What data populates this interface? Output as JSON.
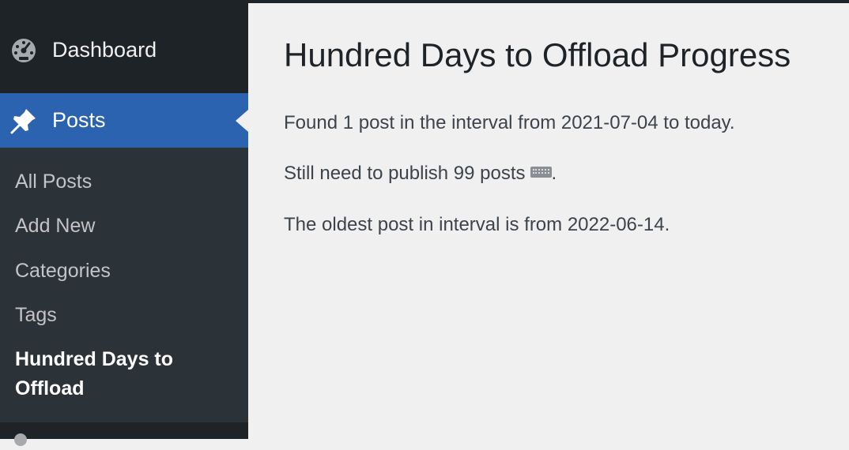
{
  "sidebar": {
    "dashboard": {
      "label": "Dashboard",
      "icon": "dashboard-gauge-icon"
    },
    "posts": {
      "label": "Posts",
      "icon": "pin-icon",
      "active_color": "#2c63b0"
    },
    "submenu": [
      {
        "label": "All Posts"
      },
      {
        "label": "Add New"
      },
      {
        "label": "Categories"
      },
      {
        "label": "Tags"
      },
      {
        "label": "Hundred Days to Offload",
        "current": true
      }
    ]
  },
  "main": {
    "title": "Hundred Days to Offload Progress",
    "lines": [
      "Found 1 post in the interval from 2021-07-04 to today.",
      "Still need to publish 99 posts",
      "The oldest post in interval is from 2022-06-14."
    ],
    "line2_suffix": ".",
    "line2_emoji": "keyboard-icon"
  },
  "colors": {
    "sidebar_bg": "#1d2327",
    "submenu_bg": "#2c3338",
    "content_bg": "#f0f0f1",
    "accent": "#2c63b0"
  }
}
